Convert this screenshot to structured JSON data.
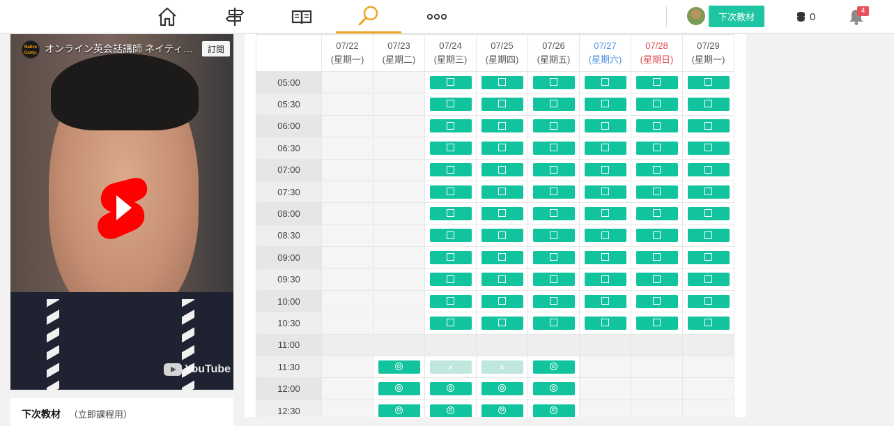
{
  "nav": {
    "items": [
      {
        "name": "home-icon"
      },
      {
        "name": "signpost-icon"
      },
      {
        "name": "book-icon"
      },
      {
        "name": "search-icon",
        "active": true
      },
      {
        "name": "more-icon"
      }
    ],
    "accent": "#f0a01e"
  },
  "header": {
    "next_material_button": "下次教材",
    "coin_count": "0",
    "notification_count": "4"
  },
  "video": {
    "channel_logo_text": "Native Camp.",
    "title": "オンライン英会話講師 ネイティ…",
    "subscribe_label": "訂閱",
    "brand_label": "YouTube"
  },
  "next_material": {
    "label": "下次教材",
    "value": "（立即課程用）"
  },
  "schedule": {
    "dates": [
      {
        "date": "07/22",
        "weekday": "(星期一)",
        "kind": "weekday"
      },
      {
        "date": "07/23",
        "weekday": "(星期二)",
        "kind": "weekday"
      },
      {
        "date": "07/24",
        "weekday": "(星期三)",
        "kind": "weekday"
      },
      {
        "date": "07/25",
        "weekday": "(星期四)",
        "kind": "weekday"
      },
      {
        "date": "07/26",
        "weekday": "(星期五)",
        "kind": "weekday"
      },
      {
        "date": "07/27",
        "weekday": "(星期六)",
        "kind": "sat"
      },
      {
        "date": "07/28",
        "weekday": "(星期日)",
        "kind": "sun"
      },
      {
        "date": "07/29",
        "weekday": "(星期一)",
        "kind": "weekday"
      }
    ],
    "legend_symbols": {
      "open": "☐",
      "reservable": "◎",
      "unavailable": "×"
    },
    "colors": {
      "slot": "#12c49d",
      "slot_unavailable": "#bfe7de",
      "saturday": "#4a90e2",
      "sunday": "#e0474c"
    },
    "rows": [
      {
        "time": "05:00",
        "slots": [
          "",
          "",
          "open",
          "open",
          "open",
          "open",
          "open",
          "open"
        ]
      },
      {
        "time": "05:30",
        "slots": [
          "",
          "",
          "open",
          "open",
          "open",
          "open",
          "open",
          "open"
        ]
      },
      {
        "time": "06:00",
        "slots": [
          "",
          "",
          "open",
          "open",
          "open",
          "open",
          "open",
          "open"
        ]
      },
      {
        "time": "06:30",
        "slots": [
          "",
          "",
          "open",
          "open",
          "open",
          "open",
          "open",
          "open"
        ]
      },
      {
        "time": "07:00",
        "slots": [
          "",
          "",
          "open",
          "open",
          "open",
          "open",
          "open",
          "open"
        ]
      },
      {
        "time": "07:30",
        "slots": [
          "",
          "",
          "open",
          "open",
          "open",
          "open",
          "open",
          "open"
        ]
      },
      {
        "time": "08:00",
        "slots": [
          "",
          "",
          "open",
          "open",
          "open",
          "open",
          "open",
          "open"
        ]
      },
      {
        "time": "08:30",
        "slots": [
          "",
          "",
          "open",
          "open",
          "open",
          "open",
          "open",
          "open"
        ]
      },
      {
        "time": "09:00",
        "slots": [
          "",
          "",
          "open",
          "open",
          "open",
          "open",
          "open",
          "open"
        ]
      },
      {
        "time": "09:30",
        "slots": [
          "",
          "",
          "open",
          "open",
          "open",
          "open",
          "open",
          "open"
        ]
      },
      {
        "time": "10:00",
        "slots": [
          "",
          "",
          "open",
          "open",
          "open",
          "open",
          "open",
          "open"
        ]
      },
      {
        "time": "10:30",
        "slots": [
          "",
          "",
          "open",
          "open",
          "open",
          "open",
          "open",
          "open"
        ]
      },
      {
        "time": "11:00",
        "slots": [
          "",
          "",
          "",
          "",
          "",
          "",
          "",
          ""
        ]
      },
      {
        "time": "11:30",
        "slots": [
          "",
          "reservable",
          "unavailable",
          "unavailable",
          "reservable",
          "",
          "",
          ""
        ]
      },
      {
        "time": "12:00",
        "slots": [
          "",
          "reservable",
          "reservable",
          "reservable",
          "reservable",
          "",
          "",
          ""
        ]
      },
      {
        "time": "12:30",
        "slots": [
          "",
          "reservable",
          "reservable",
          "reservable",
          "reservable",
          "",
          "",
          ""
        ]
      }
    ]
  }
}
